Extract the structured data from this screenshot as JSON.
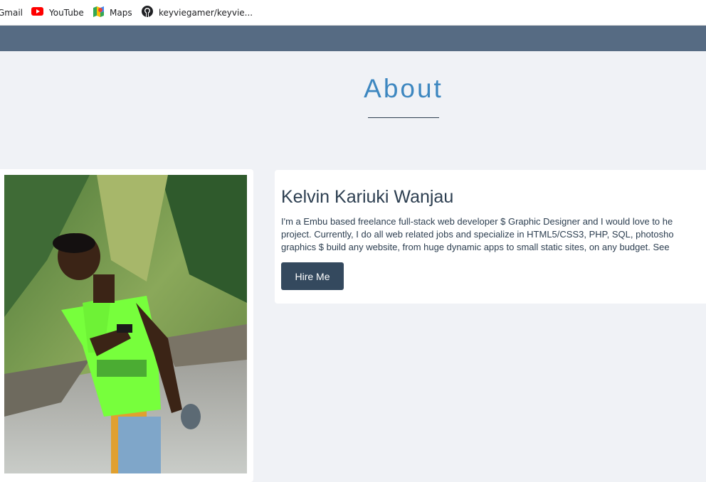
{
  "bookmarks": [
    {
      "label": "Gmail",
      "icon": "gmail-icon"
    },
    {
      "label": "YouTube",
      "icon": "youtube-icon"
    },
    {
      "label": "Maps",
      "icon": "maps-icon"
    },
    {
      "label": "keyviegamer/keyvie...",
      "icon": "github-icon"
    }
  ],
  "about": {
    "title": "About",
    "name": "Kelvin Kariuki Wanjau",
    "bio_lines": [
      "I'm a Embu based freelance full-stack web developer $ Graphic Designer and I would love to he",
      "project. Currently, I do all web related jobs and specialize in HTML5/CSS3, PHP, SQL, photosho",
      "graphics $ build any website, from huge dynamic apps to small static sites, on any budget. See"
    ],
    "hire_label": "Hire Me"
  },
  "colors": {
    "navbar": "#566b83",
    "title_accent": "#3d87c0",
    "button": "#34495e",
    "text": "#2c3e50",
    "page_bg": "#f0f2f6"
  }
}
